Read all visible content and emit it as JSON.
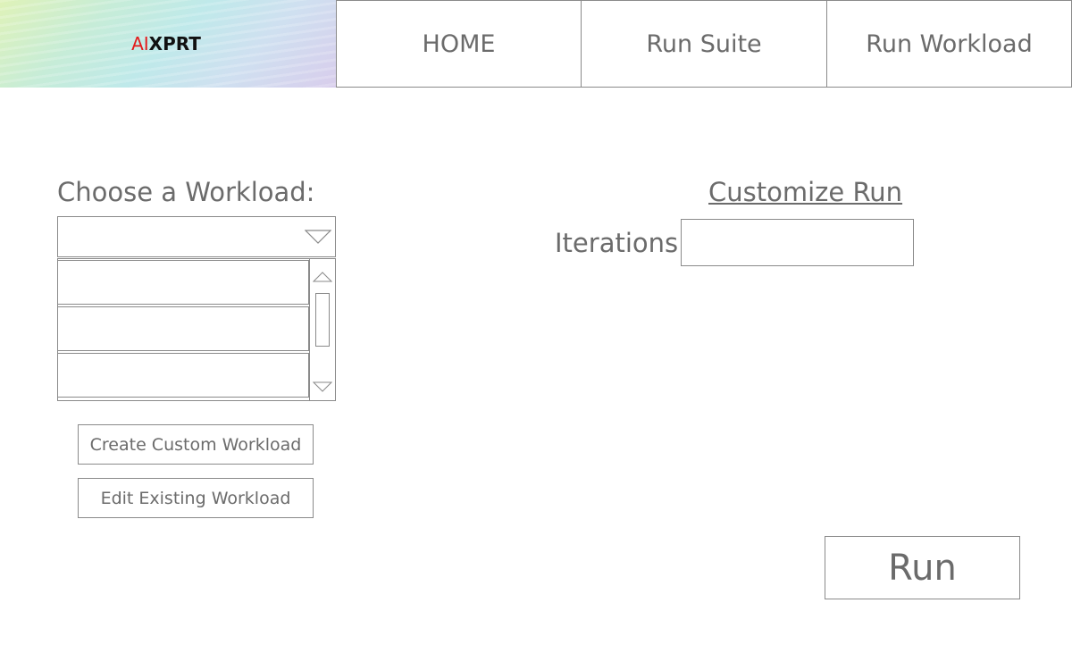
{
  "header": {
    "logo_ai": "AI",
    "logo_xprt": "XPRT",
    "tabs": [
      {
        "label": "HOME"
      },
      {
        "label": "Run Suite"
      },
      {
        "label": "Run Workload"
      }
    ]
  },
  "workload": {
    "choose_label": "Choose a Workload:",
    "dropdown_value": "",
    "list_items": [
      "",
      "",
      ""
    ],
    "create_button": "Create Custom Workload",
    "edit_button": "Edit Existing Workload"
  },
  "customize": {
    "title": "Customize Run",
    "iterations_label": "Iterations:",
    "iterations_value": ""
  },
  "run_button": "Run",
  "colors": {
    "logo_ai": "#e21b1b",
    "logo_xprt": "#111111",
    "text": "#6b6b6b",
    "border": "#8a8a8a"
  },
  "icons": [
    "chevron-down-icon",
    "scroll-up-arrow-icon",
    "scroll-down-arrow-icon"
  ]
}
